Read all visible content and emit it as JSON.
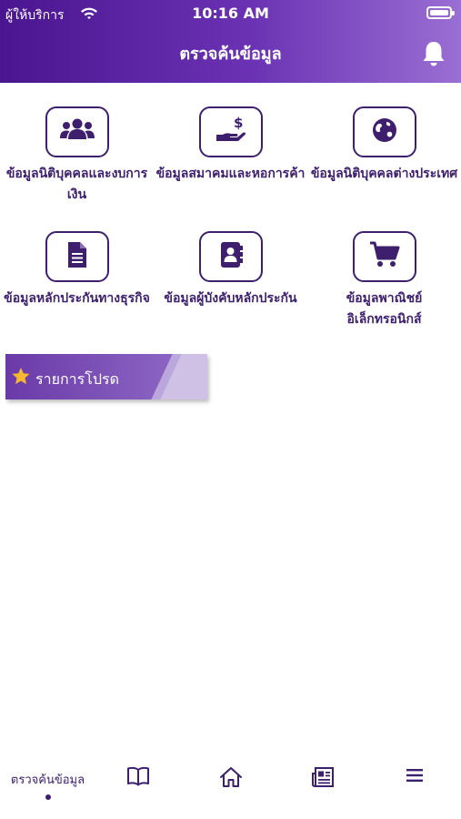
{
  "status_bar": {
    "carrier": "ผู้ให้บริการ",
    "time": "10:16 AM"
  },
  "header": {
    "title": "ตรวจค้นข้อมูล"
  },
  "tiles": [
    {
      "label": "ข้อมูลนิติบุคคลและงบการเงิน",
      "icon": "group-icon"
    },
    {
      "label": "ข้อมูลสมาคมและหอการค้า",
      "icon": "hand-money-icon"
    },
    {
      "label": "ข้อมูลนิติบุคคลต่างประเทศ",
      "icon": "globe-icon"
    },
    {
      "label": "ข้อมูลหลักประกันทางธุรกิจ",
      "icon": "document-icon"
    },
    {
      "label": "ข้อมูลผู้บังคับหลักประกัน",
      "icon": "contact-book-icon"
    },
    {
      "label": "ข้อมูลพาณิชย์อิเล็กทรอนิกส์",
      "icon": "cart-icon"
    }
  ],
  "favorites": {
    "label": "รายการโปรด"
  },
  "tabbar": {
    "search_label": "ตรวจค้นข้อมูล",
    "items": [
      "book-icon",
      "home-icon",
      "newspaper-icon",
      "menu-icon"
    ]
  },
  "colors": {
    "primary": "#3d1f6e",
    "header_start": "#4a1590",
    "header_end": "#9a6fd3",
    "star": "#f5b82e"
  }
}
